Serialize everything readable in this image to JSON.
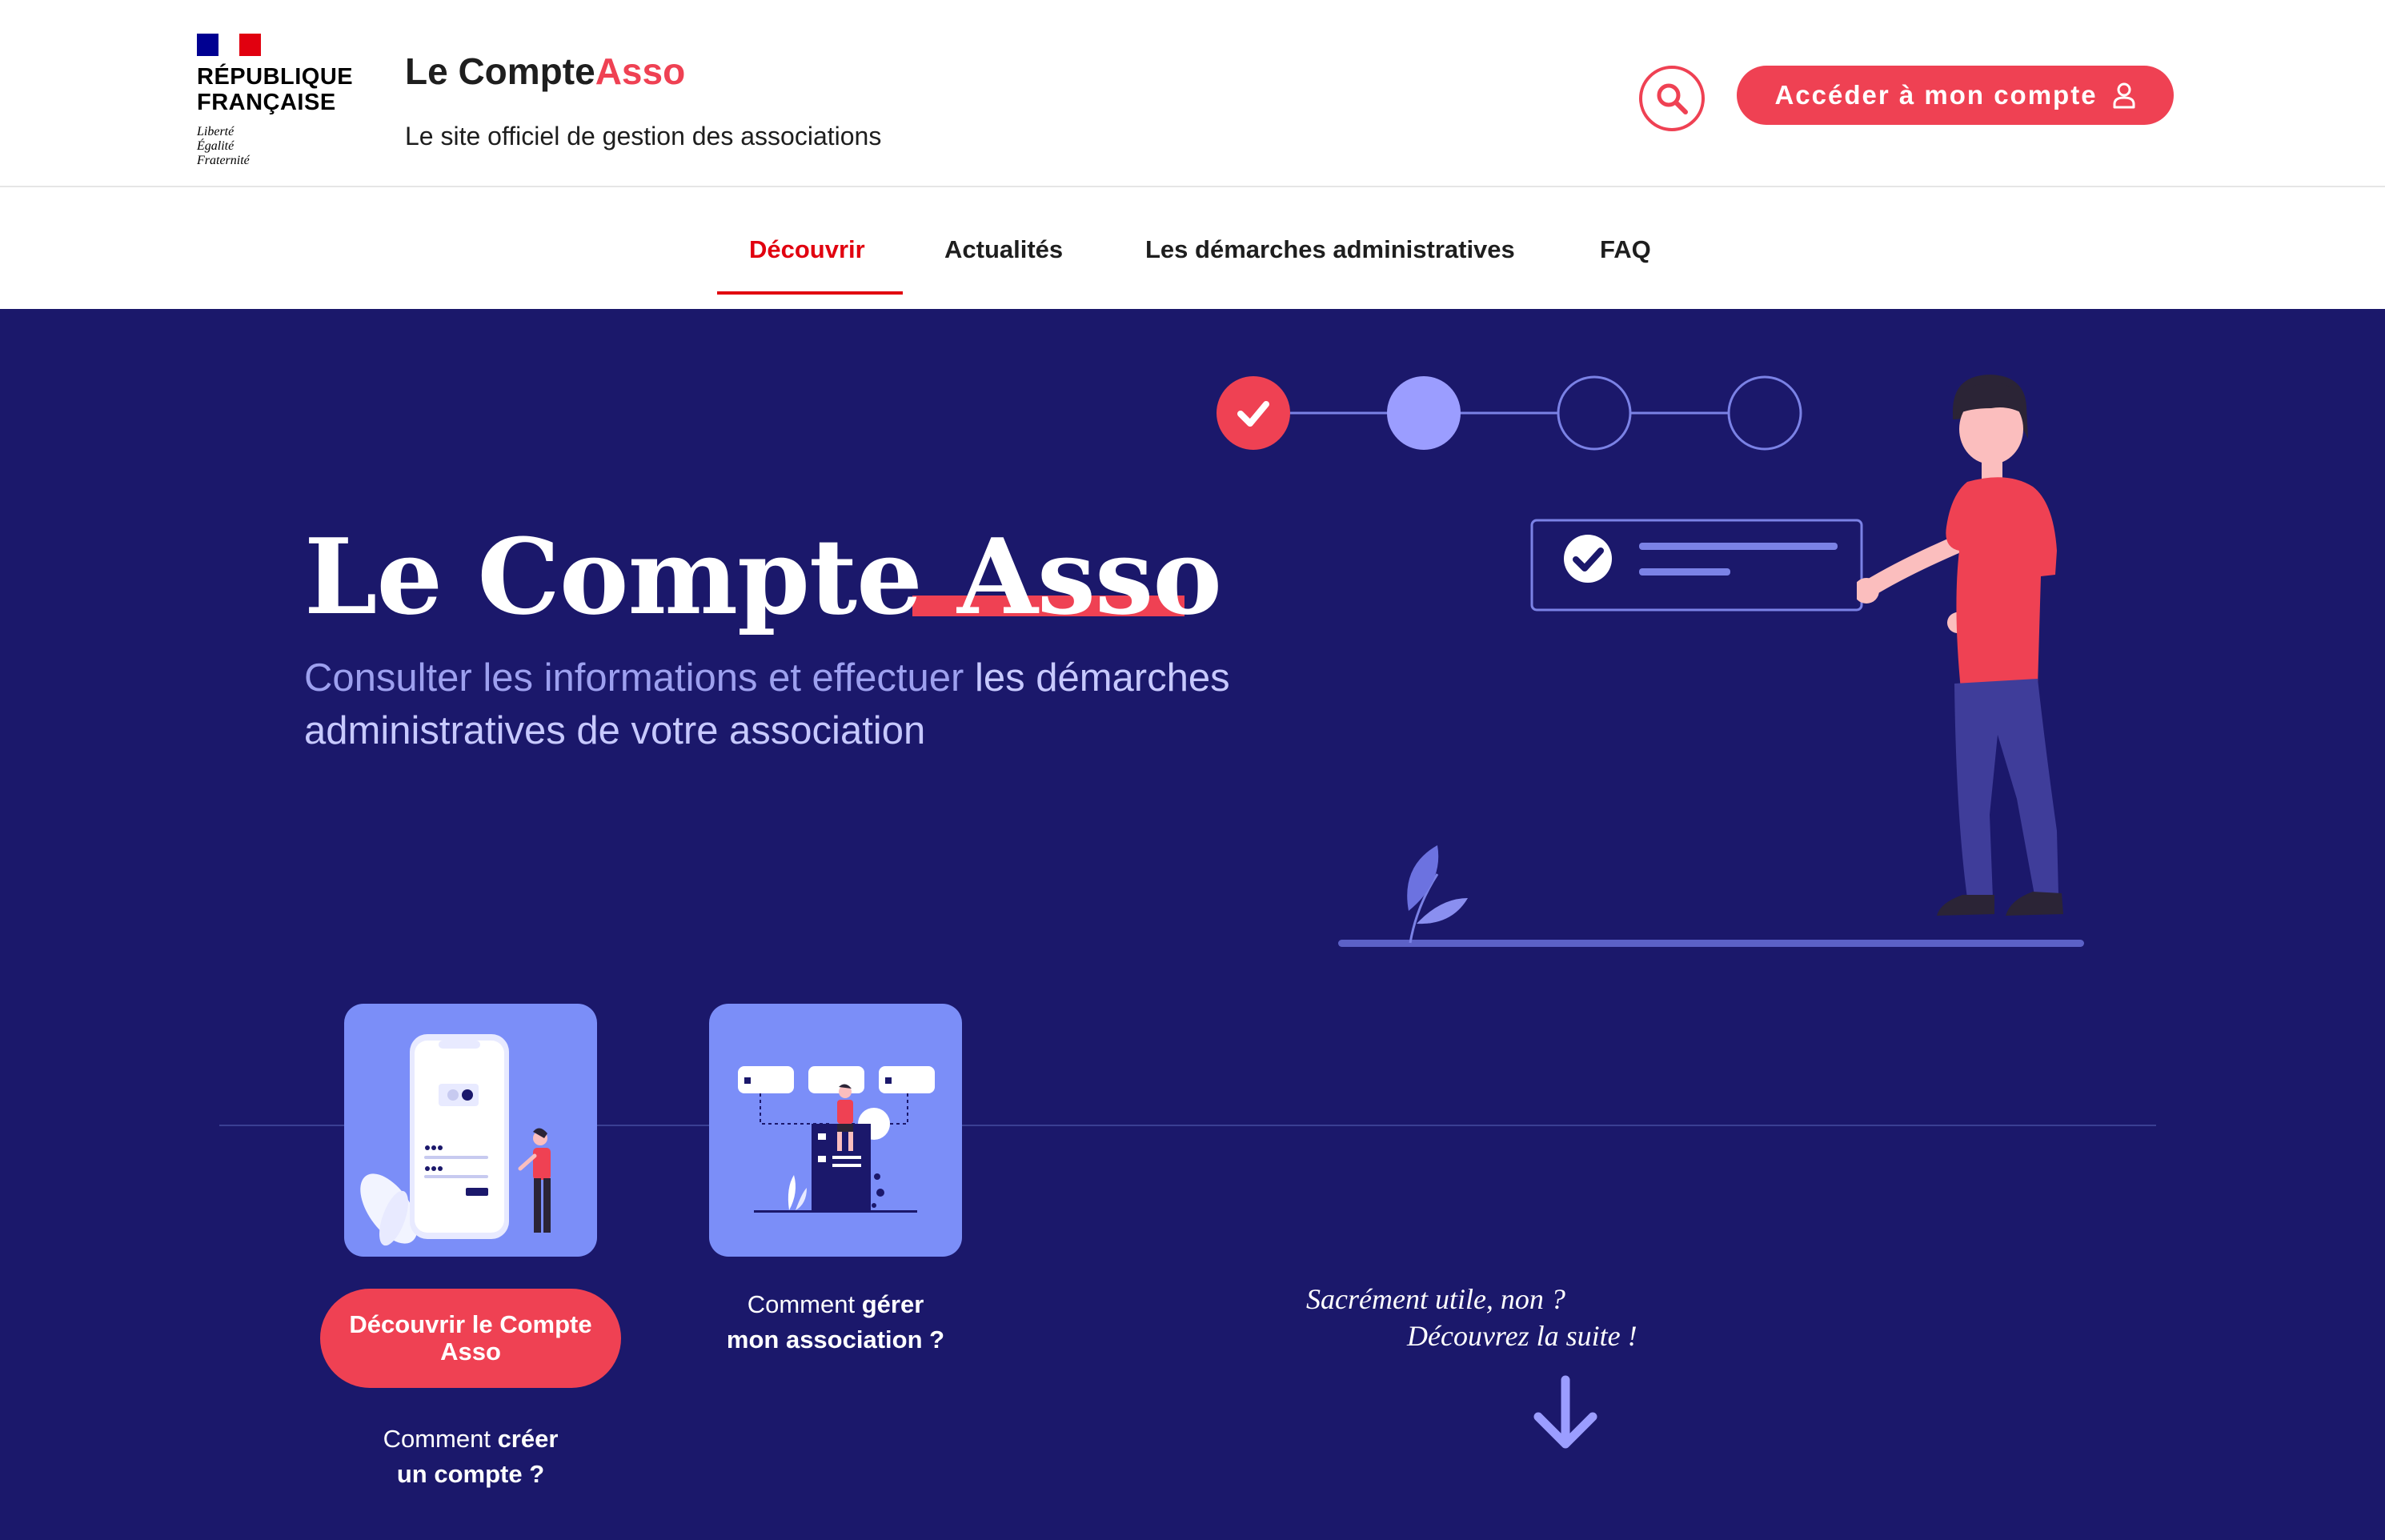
{
  "header": {
    "republic": {
      "line1": "RÉPUBLIQUE",
      "line2": "FRANÇAISE",
      "motto1": "Liberté",
      "motto2": "Égalité",
      "motto3": "Fraternité"
    },
    "brand_prefix": "Le Compte",
    "brand_accent": "Asso",
    "tagline": "Le site officiel de gestion des associations",
    "search_icon": "search-icon",
    "account_label": "Accéder à mon compte",
    "account_icon": "user-icon"
  },
  "nav": {
    "items": [
      {
        "label": "Découvrir",
        "active": true
      },
      {
        "label": "Actualités",
        "active": false
      },
      {
        "label": "Les démarches administratives",
        "active": false
      },
      {
        "label": "FAQ",
        "active": false
      }
    ]
  },
  "hero": {
    "title_part1": "Le Compte",
    "title_part2": "Asso",
    "subtitle_part1": "Consulter les informations et effectuer",
    "subtitle_bold": "les démarches administratives de votre association",
    "steps": {
      "total": 4,
      "completed": 1,
      "current": 2
    },
    "cards": [
      {
        "cta": "Découvrir le Compte Asso",
        "link_pre": "Comment",
        "link_bold1": "créer",
        "link_bold2": "un compte ?"
      },
      {
        "link_pre": "Comment",
        "link_bold1": "gérer",
        "link_bold2": "mon association ?"
      }
    ],
    "teaser_line1": "Sacrément utile, non ?",
    "teaser_line2": "Découvrez la suite !",
    "arrow_icon": "arrow-down-icon"
  },
  "colors": {
    "accent_red": "#ef4153",
    "nav_active_red": "#e1000f",
    "hero_background": "#1b186b",
    "card_background": "#7b8ef8",
    "step_current": "#9b9dff"
  }
}
